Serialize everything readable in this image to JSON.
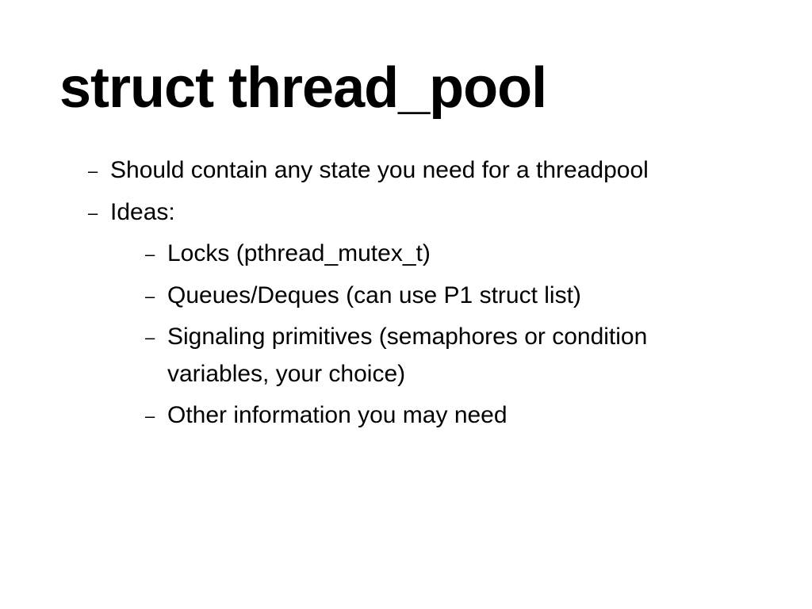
{
  "slide": {
    "title": "struct thread_pool",
    "bullets": [
      {
        "level": 1,
        "text": "Should contain any state you need for a threadpool"
      },
      {
        "level": 1,
        "text": "Ideas:"
      },
      {
        "level": 2,
        "text": "Locks (pthread_mutex_t)"
      },
      {
        "level": 2,
        "text": "Queues/Deques (can use P1 struct list)"
      },
      {
        "level": 2,
        "text": "Signaling primitives (semaphores or condition variables, your choice)"
      },
      {
        "level": 2,
        "text": "Other information you may need"
      }
    ]
  }
}
